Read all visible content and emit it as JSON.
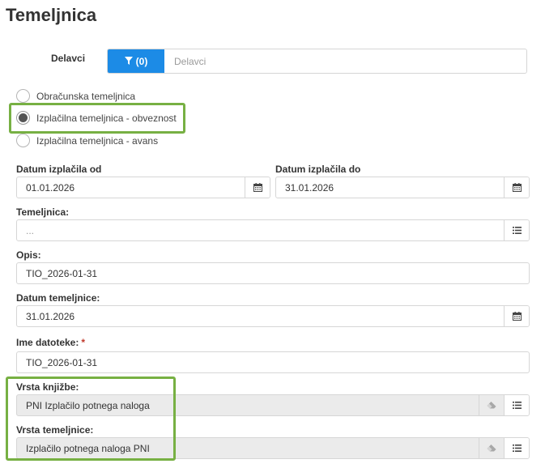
{
  "page": {
    "title": "Temeljnica"
  },
  "filter": {
    "label": "Delavci",
    "button_label": "(0)",
    "value": "Delavci"
  },
  "radios": [
    {
      "label": "Obračunska temeljnica",
      "checked": false
    },
    {
      "label": "Izplačilna temeljnica - obveznost",
      "checked": true
    },
    {
      "label": "Izplačilna temeljnica - avans",
      "checked": false
    }
  ],
  "fields": {
    "date_from": {
      "label": "Datum izplačila od",
      "value": "01.01.2026"
    },
    "date_to": {
      "label": "Datum izplačila do",
      "value": "31.01.2026"
    },
    "temeljnica": {
      "label": "Temeljnica:",
      "value": "..."
    },
    "opis": {
      "label": "Opis:",
      "value": "TIO_2026-01-31"
    },
    "datum_temeljnice": {
      "label": "Datum temeljnice:",
      "value": "31.01.2026"
    },
    "ime_datoteke": {
      "label": "Ime datoteke:",
      "required_mark": "*",
      "value": "TIO_2026-01-31"
    },
    "vrsta_knjizbe": {
      "label": "Vrsta knjižbe:",
      "value": "PNI Izplačilo potnega naloga"
    },
    "vrsta_temeljnice": {
      "label": "Vrsta temeljnice:",
      "value": "Izplačilo potnega naloga PNI"
    }
  },
  "icons": {
    "filter": "filter-icon",
    "calendar": "calendar-icon",
    "list": "list-icon",
    "eraser": "eraser-icon"
  },
  "colors": {
    "primary": "#1c8be6",
    "highlight": "#77b043",
    "readonly_bg": "#ebebeb",
    "border": "#d6d6d6",
    "required": "#c0392b"
  }
}
